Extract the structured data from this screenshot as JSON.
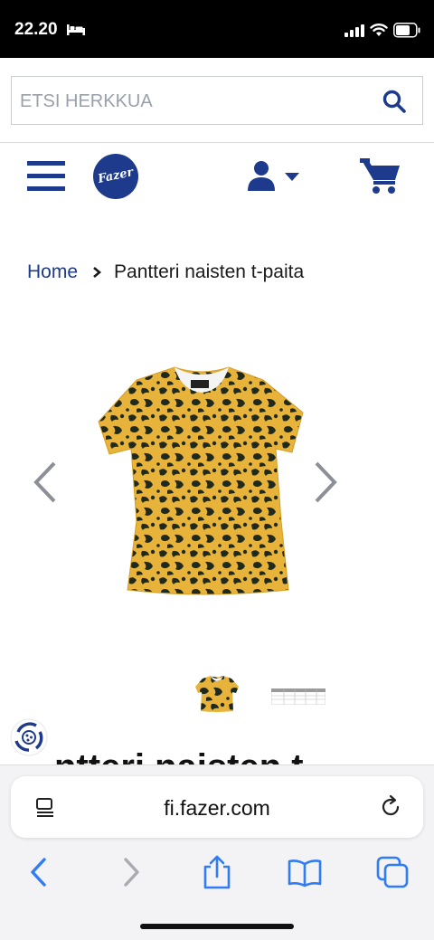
{
  "status_bar": {
    "time": "22.20",
    "icons": [
      "bed-icon",
      "signal-icon",
      "wifi-icon",
      "battery-icon"
    ]
  },
  "search": {
    "placeholder": "ETSI HERKKUA",
    "icon": "search-icon"
  },
  "header": {
    "logo_text": "Fazer",
    "icons": [
      "menu-icon",
      "account-icon",
      "cart-icon"
    ]
  },
  "breadcrumb": {
    "home": "Home",
    "current": "Pantteri naisten t-paita"
  },
  "gallery": {
    "images": [
      "leopard-print-tshirt",
      "size-chart"
    ],
    "icons": [
      "chevron-left-icon",
      "chevron-right-icon"
    ]
  },
  "product": {
    "title_visible_fragment": "ntteri naisten t"
  },
  "browser": {
    "url": "fi.fazer.com",
    "icons": [
      "reader-icon",
      "reload-icon",
      "back-icon",
      "forward-icon",
      "share-icon",
      "bookmarks-icon",
      "tabs-icon"
    ]
  },
  "colors": {
    "brand_blue": "#1e3a8c",
    "leopard_base": "#e8b33a",
    "leopard_spot": "#1f2a1f",
    "toolbar_blue": "#2f7cf6"
  }
}
